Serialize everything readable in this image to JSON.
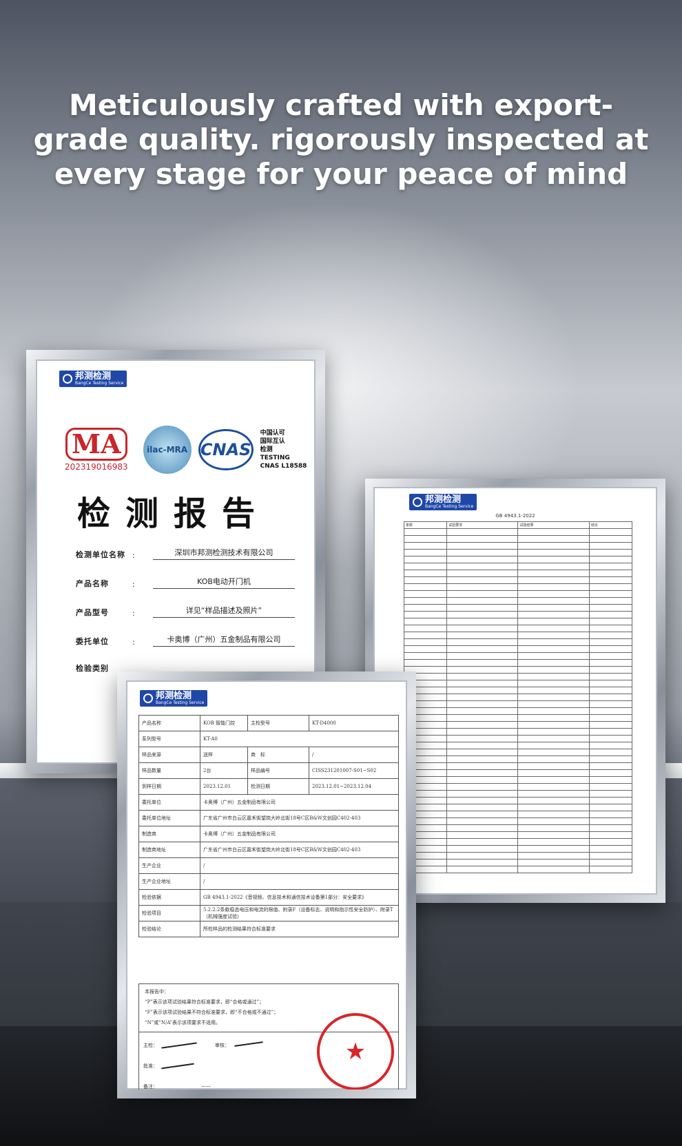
{
  "headline": "Meticulously crafted with export-grade quality. rigorously inspected at every stage for your peace of mind",
  "logo": {
    "cn": "邦测检测",
    "en": "BangCe Testing Service"
  },
  "report": {
    "cma_number": "202319016983",
    "ilac": "ilac-MRA",
    "cnas": "CNAS",
    "cnas_text": [
      "中国认可",
      "国际互认",
      "检测",
      "TESTING",
      "CNAS L18588"
    ],
    "title": "检测报告",
    "fields": [
      {
        "label": "检测单位名称",
        "value": "深圳市邦测检测技术有限公司"
      },
      {
        "label": "产品名称",
        "value": "KOB电动开门机"
      },
      {
        "label": "产品型号",
        "value": "详见“样品描述及照片”"
      },
      {
        "label": "委托单位",
        "value": "卡奥博（广州）五金制品有限公司"
      },
      {
        "label": "检验类别",
        "value": ""
      }
    ]
  },
  "standard": {
    "title": "GB 4943.1-2022",
    "headers": [
      "条款",
      "试验要求",
      "试验结果",
      "结论"
    ]
  },
  "info_rows": [
    [
      "产品名称",
      "KOB 智能门控",
      "主检型号",
      "KT-D4000"
    ],
    [
      "系列型号",
      "KT-A0",
      "",
      ""
    ],
    [
      "样品来源",
      "送样",
      "商　标",
      "/"
    ],
    [
      "样品数量",
      "2台",
      "样品编号",
      "CISS231201007-S01~S02"
    ],
    [
      "到样日期",
      "2023.12.01",
      "检测日期",
      "2023.12.01~2023.12.04"
    ],
    [
      "委托单位",
      "卡奥博（广州）五金制品有限公司",
      "",
      ""
    ],
    [
      "委托单位地址",
      "广东省广州市白云区嘉禾街望岗大岭北街18号C区B&W文创园C402-403",
      "",
      ""
    ],
    [
      "制造商",
      "卡奥博（广州）五金制品有限公司",
      "",
      ""
    ],
    [
      "制造商地址",
      "广东省广州市白云区嘉禾街望岗大岭北街18号C区B&W文创园C402-403",
      "",
      ""
    ],
    [
      "生产企业",
      "/",
      "",
      ""
    ],
    [
      "生产企业地址",
      "/",
      "",
      ""
    ],
    [
      "检验依据",
      "GB 4943.1-2022《音视频、信息技术和通信技术设备第1部分：安全要求》",
      "",
      ""
    ],
    [
      "检验项目",
      "5.2.2.2条款稳态电压和电流的限值、附录F（设备标志、说明和指示性安全防护）、附录T（机械强度试验）",
      "",
      ""
    ],
    [
      "检验结论",
      "所检样品的检测结果符合标准要求",
      "",
      ""
    ]
  ],
  "notes": [
    "本报告中：",
    "“P”表示该项试验结果符合标准要求，即“合格或通过”；",
    "“F”表示该项试验结果不符合标准要求，即“不合格或不通过”；",
    "“N”或“N/A”表示该项要求不适用。"
  ],
  "signatures": {
    "main": "主检：",
    "review": "审核：",
    "approve": "批准：",
    "remark": "备注：",
    "remark_value": "——"
  }
}
